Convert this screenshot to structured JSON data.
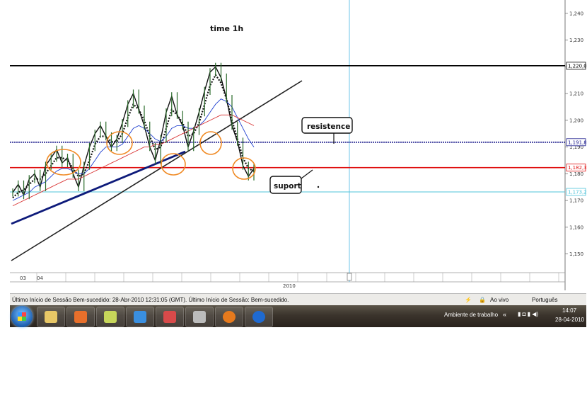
{
  "chart_data": {
    "type": "line",
    "title": "time 1h",
    "ylim": [
      1.143,
      1.245
    ],
    "y_ticks": [
      "1,240",
      "1,230",
      "1,220",
      "1,210",
      "1,200",
      "1,190",
      "1,180",
      "1,170",
      "1,160",
      "1,150"
    ],
    "x_ticks": [
      "03",
      "04"
    ],
    "x_year": "2010",
    "series": [
      {
        "values": [
          1.173,
          1.176,
          1.172,
          1.178,
          1.18,
          1.175,
          1.183,
          1.186,
          1.189,
          1.184,
          1.186,
          1.18,
          1.175,
          1.183,
          1.19,
          1.195,
          1.198,
          1.194,
          1.19,
          1.193,
          1.199,
          1.206,
          1.21,
          1.204,
          1.198,
          1.19,
          1.185,
          1.193,
          1.203,
          1.209,
          1.202,
          1.198,
          1.19,
          1.196,
          1.203,
          1.211,
          1.218,
          1.22,
          1.216,
          1.208,
          1.198,
          1.192,
          1.183,
          1.179,
          1.182
        ]
      },
      {
        "values": [
          1.171,
          1.173,
          1.174,
          1.176,
          1.178,
          1.178,
          1.18,
          1.183,
          1.186,
          1.186,
          1.185,
          1.182,
          1.179,
          1.18,
          1.185,
          1.191,
          1.194,
          1.194,
          1.192,
          1.192,
          1.195,
          1.201,
          1.206,
          1.204,
          1.2,
          1.194,
          1.189,
          1.19,
          1.197,
          1.204,
          1.202,
          1.199,
          1.194,
          1.195,
          1.199,
          1.206,
          1.213,
          1.217,
          1.214,
          1.208,
          1.2,
          1.193,
          1.186,
          1.182,
          1.181
        ]
      },
      {
        "values": [
          1.17,
          1.171,
          1.172,
          1.173,
          1.175,
          1.176,
          1.177,
          1.179,
          1.181,
          1.182,
          1.182,
          1.181,
          1.18,
          1.18,
          1.182,
          1.185,
          1.188,
          1.19,
          1.19,
          1.19,
          1.191,
          1.194,
          1.197,
          1.198,
          1.197,
          1.195,
          1.193,
          1.192,
          1.194,
          1.197,
          1.198,
          1.198,
          1.197,
          1.197,
          1.198,
          1.2,
          1.203,
          1.206,
          1.208,
          1.207,
          1.205,
          1.201,
          1.197,
          1.193,
          1.19
        ]
      },
      {
        "values": [
          1.168,
          1.169,
          1.17,
          1.171,
          1.172,
          1.173,
          1.174,
          1.175,
          1.176,
          1.177,
          1.178,
          1.178,
          1.178,
          1.179,
          1.18,
          1.181,
          1.182,
          1.183,
          1.184,
          1.185,
          1.186,
          1.187,
          1.188,
          1.189,
          1.19,
          1.19,
          1.191,
          1.191,
          1.192,
          1.193,
          1.194,
          1.195,
          1.196,
          1.197,
          1.198,
          1.199,
          1.2,
          1.201,
          1.202,
          1.202,
          1.202,
          1.201,
          1.2,
          1.199,
          1.198
        ]
      }
    ],
    "hlines": [
      {
        "label": "1,220,0",
        "y": 1.2204,
        "color": "#000000"
      },
      {
        "label": "1,191,8",
        "y": 1.1918,
        "color": "#1a1a8c"
      },
      {
        "label": "1,182,3",
        "y": 1.1823,
        "color": "#e01010"
      },
      {
        "label": "1,173,2",
        "y": 1.1732,
        "color": "#4fc3d9"
      }
    ],
    "annotations": [
      {
        "text": "resistence"
      },
      {
        "text": "suport"
      }
    ]
  },
  "status": {
    "message": "Último Início de Sessão Bem-sucedido: 28-Abr-2010 12:31:05 (GMT). Último Início de Sessão: Bem-sucedido.",
    "live": "Ao vivo",
    "language": "Português"
  },
  "taskbar": {
    "desktop_label": "Ambiente de trabalho",
    "time": "14:07",
    "date": "28-04-2010"
  },
  "colors": {
    "trend_thick": "#0d1a7a",
    "trend_thin": "#222222",
    "circle": "#f08a24",
    "vline": "#6ec6e8"
  }
}
